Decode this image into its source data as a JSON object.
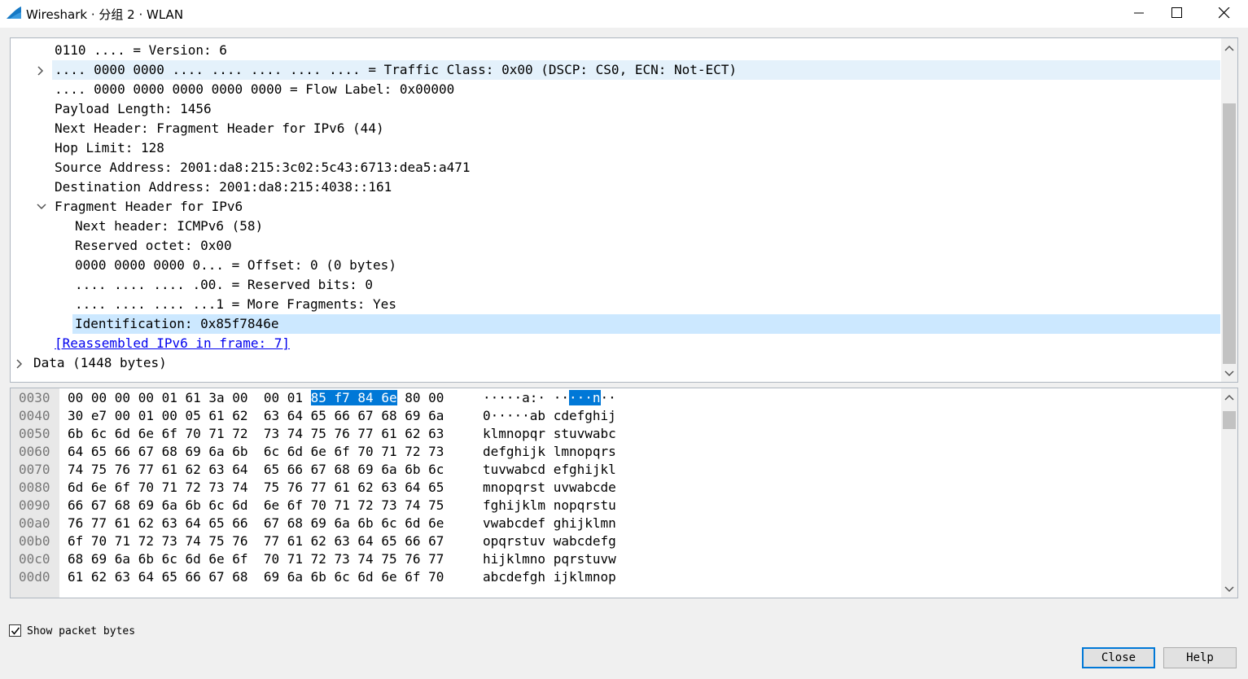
{
  "window": {
    "title": "Wireshark · 分组 2 · WLAN",
    "minimize_icon": "minimize-icon",
    "maximize_icon": "maximize-icon",
    "close_icon": "close-icon"
  },
  "detail_tree": {
    "rows": [
      {
        "text": "0110 .... = Version: 6",
        "indent": 1,
        "expander": "none",
        "state": "normal"
      },
      {
        "text": ".... 0000 0000 .... .... .... .... .... = Traffic Class: 0x00 (DSCP: CS0, ECN: Not-ECT)",
        "indent": 1,
        "expander": "collapsed",
        "state": "hover"
      },
      {
        "text": ".... 0000 0000 0000 0000 0000 = Flow Label: 0x00000",
        "indent": 1,
        "expander": "none",
        "state": "normal"
      },
      {
        "text": "Payload Length: 1456",
        "indent": 1,
        "expander": "none",
        "state": "normal"
      },
      {
        "text": "Next Header: Fragment Header for IPv6 (44)",
        "indent": 1,
        "expander": "none",
        "state": "normal"
      },
      {
        "text": "Hop Limit: 128",
        "indent": 1,
        "expander": "none",
        "state": "normal"
      },
      {
        "text": "Source Address: 2001:da8:215:3c02:5c43:6713:dea5:a471",
        "indent": 1,
        "expander": "none",
        "state": "normal"
      },
      {
        "text": "Destination Address: 2001:da8:215:4038::161",
        "indent": 1,
        "expander": "none",
        "state": "normal"
      },
      {
        "text": "Fragment Header for IPv6",
        "indent": 1,
        "expander": "expanded",
        "state": "normal"
      },
      {
        "text": "Next header: ICMPv6 (58)",
        "indent": 2,
        "expander": "none",
        "state": "normal"
      },
      {
        "text": "Reserved octet: 0x00",
        "indent": 2,
        "expander": "none",
        "state": "normal"
      },
      {
        "text": "0000 0000 0000 0... = Offset: 0 (0 bytes)",
        "indent": 2,
        "expander": "none",
        "state": "normal"
      },
      {
        "text": ".... .... .... .00. = Reserved bits: 0",
        "indent": 2,
        "expander": "none",
        "state": "normal"
      },
      {
        "text": ".... .... .... ...1 = More Fragments: Yes",
        "indent": 2,
        "expander": "none",
        "state": "normal"
      },
      {
        "text": "Identification: 0x85f7846e",
        "indent": 2,
        "expander": "none",
        "state": "selected"
      },
      {
        "text": "[Reassembled IPv6 in frame: 7]",
        "indent": 1,
        "expander": "none",
        "state": "link"
      },
      {
        "text": "Data (1448 bytes)",
        "indent": 0,
        "expander": "collapsed",
        "state": "normal"
      }
    ]
  },
  "hex_dump": {
    "rows": [
      {
        "offset": "0030",
        "hex_a": "00 00 00 00 01 61 3a 00",
        "hex_b_pre": "00 01 ",
        "hex_b_sel": "85 f7 84 6e",
        "hex_b_post": " 80 00",
        "ascii_a": "·····a:·",
        "ascii_b_pre": " ··",
        "ascii_b_sel": "···n",
        "ascii_b_post": "··"
      },
      {
        "offset": "0040",
        "hex_a": "30 e7 00 01 00 05 61 62",
        "hex_b_pre": "63 64 65 66 67 68 69 6a",
        "hex_b_sel": "",
        "hex_b_post": "",
        "ascii_a": "0·····ab",
        "ascii_b_pre": " cdefghij",
        "ascii_b_sel": "",
        "ascii_b_post": ""
      },
      {
        "offset": "0050",
        "hex_a": "6b 6c 6d 6e 6f 70 71 72",
        "hex_b_pre": "73 74 75 76 77 61 62 63",
        "hex_b_sel": "",
        "hex_b_post": "",
        "ascii_a": "klmnopqr",
        "ascii_b_pre": " stuvwabc",
        "ascii_b_sel": "",
        "ascii_b_post": ""
      },
      {
        "offset": "0060",
        "hex_a": "64 65 66 67 68 69 6a 6b",
        "hex_b_pre": "6c 6d 6e 6f 70 71 72 73",
        "hex_b_sel": "",
        "hex_b_post": "",
        "ascii_a": "defghijk",
        "ascii_b_pre": " lmnopqrs",
        "ascii_b_sel": "",
        "ascii_b_post": ""
      },
      {
        "offset": "0070",
        "hex_a": "74 75 76 77 61 62 63 64",
        "hex_b_pre": "65 66 67 68 69 6a 6b 6c",
        "hex_b_sel": "",
        "hex_b_post": "",
        "ascii_a": "tuvwabcd",
        "ascii_b_pre": " efghijkl",
        "ascii_b_sel": "",
        "ascii_b_post": ""
      },
      {
        "offset": "0080",
        "hex_a": "6d 6e 6f 70 71 72 73 74",
        "hex_b_pre": "75 76 77 61 62 63 64 65",
        "hex_b_sel": "",
        "hex_b_post": "",
        "ascii_a": "mnopqrst",
        "ascii_b_pre": " uvwabcde",
        "ascii_b_sel": "",
        "ascii_b_post": ""
      },
      {
        "offset": "0090",
        "hex_a": "66 67 68 69 6a 6b 6c 6d",
        "hex_b_pre": "6e 6f 70 71 72 73 74 75",
        "hex_b_sel": "",
        "hex_b_post": "",
        "ascii_a": "fghijklm",
        "ascii_b_pre": " nopqrstu",
        "ascii_b_sel": "",
        "ascii_b_post": ""
      },
      {
        "offset": "00a0",
        "hex_a": "76 77 61 62 63 64 65 66",
        "hex_b_pre": "67 68 69 6a 6b 6c 6d 6e",
        "hex_b_sel": "",
        "hex_b_post": "",
        "ascii_a": "vwabcdef",
        "ascii_b_pre": " ghijklmn",
        "ascii_b_sel": "",
        "ascii_b_post": ""
      },
      {
        "offset": "00b0",
        "hex_a": "6f 70 71 72 73 74 75 76",
        "hex_b_pre": "77 61 62 63 64 65 66 67",
        "hex_b_sel": "",
        "hex_b_post": "",
        "ascii_a": "opqrstuv",
        "ascii_b_pre": " wabcdefg",
        "ascii_b_sel": "",
        "ascii_b_post": ""
      },
      {
        "offset": "00c0",
        "hex_a": "68 69 6a 6b 6c 6d 6e 6f",
        "hex_b_pre": "70 71 72 73 74 75 76 77",
        "hex_b_sel": "",
        "hex_b_post": "",
        "ascii_a": "hijklmno",
        "ascii_b_pre": " pqrstuvw",
        "ascii_b_sel": "",
        "ascii_b_post": ""
      },
      {
        "offset": "00d0",
        "hex_a": "61 62 63 64 65 66 67 68",
        "hex_b_pre": "69 6a 6b 6c 6d 6e 6f 70",
        "hex_b_sel": "",
        "hex_b_post": "",
        "ascii_a": "abcdefgh",
        "ascii_b_pre": " ijklmnop",
        "ascii_b_sel": "",
        "ascii_b_post": ""
      }
    ]
  },
  "footer": {
    "show_packet_bytes_label": "Show packet bytes",
    "show_packet_bytes_checked": true,
    "close_label": "Close",
    "help_label": "Help"
  },
  "colors": {
    "selection": "#0078d7",
    "tree_selected": "#cce8ff",
    "tree_hover": "#e4f1fb",
    "link": "#0000ee"
  }
}
